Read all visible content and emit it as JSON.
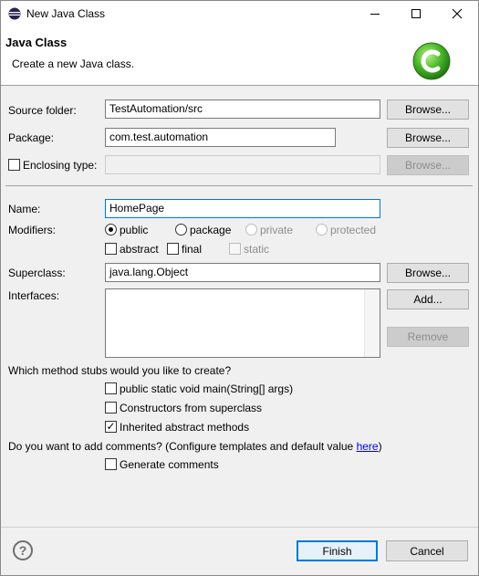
{
  "window": {
    "title": "New Java Class"
  },
  "header": {
    "title": "Java Class",
    "description": "Create a new Java class."
  },
  "source_folder": {
    "label": "Source folder:",
    "value": "TestAutomation/src",
    "browse": "Browse..."
  },
  "package": {
    "label": "Package:",
    "value": "com.test.automation",
    "browse": "Browse..."
  },
  "enclosing_type": {
    "label": "Enclosing type:",
    "checked": false,
    "value": "",
    "browse": "Browse..."
  },
  "name": {
    "label": "Name:",
    "value": "HomePage"
  },
  "modifiers": {
    "label": "Modifiers:",
    "public": "public",
    "package": "package",
    "private": "private",
    "protected": "protected",
    "abstract": "abstract",
    "final": "final",
    "static": "static",
    "selected": "public"
  },
  "superclass": {
    "label": "Superclass:",
    "value": "java.lang.Object",
    "browse": "Browse..."
  },
  "interfaces": {
    "label": "Interfaces:",
    "add": "Add...",
    "remove": "Remove"
  },
  "stubs": {
    "question": "Which method stubs would you like to create?",
    "main": "public static void main(String[] args)",
    "main_checked": false,
    "constructors": "Constructors from superclass",
    "constructors_checked": false,
    "inherited": "Inherited abstract methods",
    "inherited_checked": true
  },
  "comments": {
    "question_prefix": "Do you want to add comments? (Configure templates and default value ",
    "link": "here",
    "question_suffix": ")",
    "generate": "Generate comments",
    "generate_checked": false
  },
  "footer": {
    "help": "?",
    "finish": "Finish",
    "cancel": "Cancel"
  },
  "colors": {
    "accent": "#0078d7",
    "logo_green": "#3aa31c",
    "link": "#0000ee"
  }
}
